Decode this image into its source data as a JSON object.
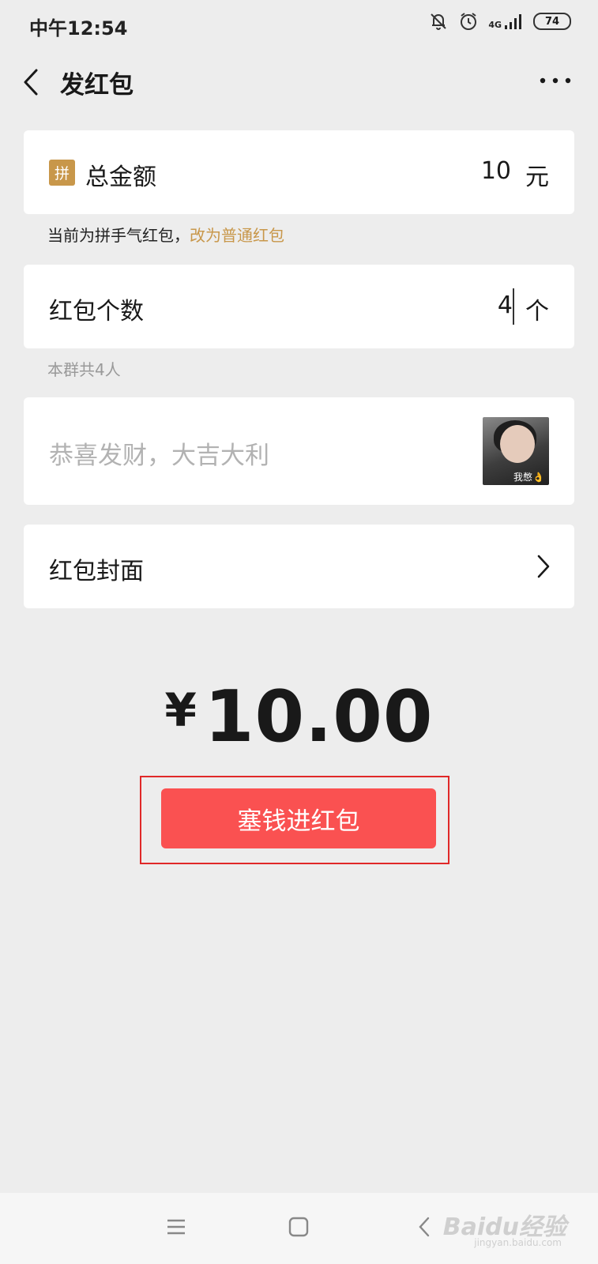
{
  "status_bar": {
    "time": "中午12:54",
    "network": "4G",
    "battery": "74",
    "icons": [
      "mute-bell-icon",
      "alarm-icon",
      "signal-icon",
      "battery-icon"
    ]
  },
  "header": {
    "title": "发红包",
    "back_icon": "chevron-left-icon",
    "more_icon": "more-dots-icon"
  },
  "total_amount": {
    "badge": "拼",
    "label": "总金额",
    "value": "10",
    "unit": "元"
  },
  "type_hint": {
    "text": "当前为拼手气红包，",
    "link": "改为普通红包"
  },
  "packet_count": {
    "label": "红包个数",
    "value": "4",
    "unit": "个"
  },
  "group_hint": "本群共4人",
  "message": {
    "placeholder": "恭喜发财，大吉大利",
    "emoji_caption": "我憋👌"
  },
  "cover": {
    "label": "红包封面"
  },
  "amount_display": {
    "currency": "¥",
    "value": "10.00"
  },
  "send_button": "塞钱进红包",
  "watermark": {
    "text": "Baidu经验",
    "sub": "jingyan.baidu.com"
  },
  "colors": {
    "background": "#ededed",
    "accent_gold": "#c8974a",
    "button_red": "#fa5151",
    "highlight_frame": "#e02828"
  }
}
